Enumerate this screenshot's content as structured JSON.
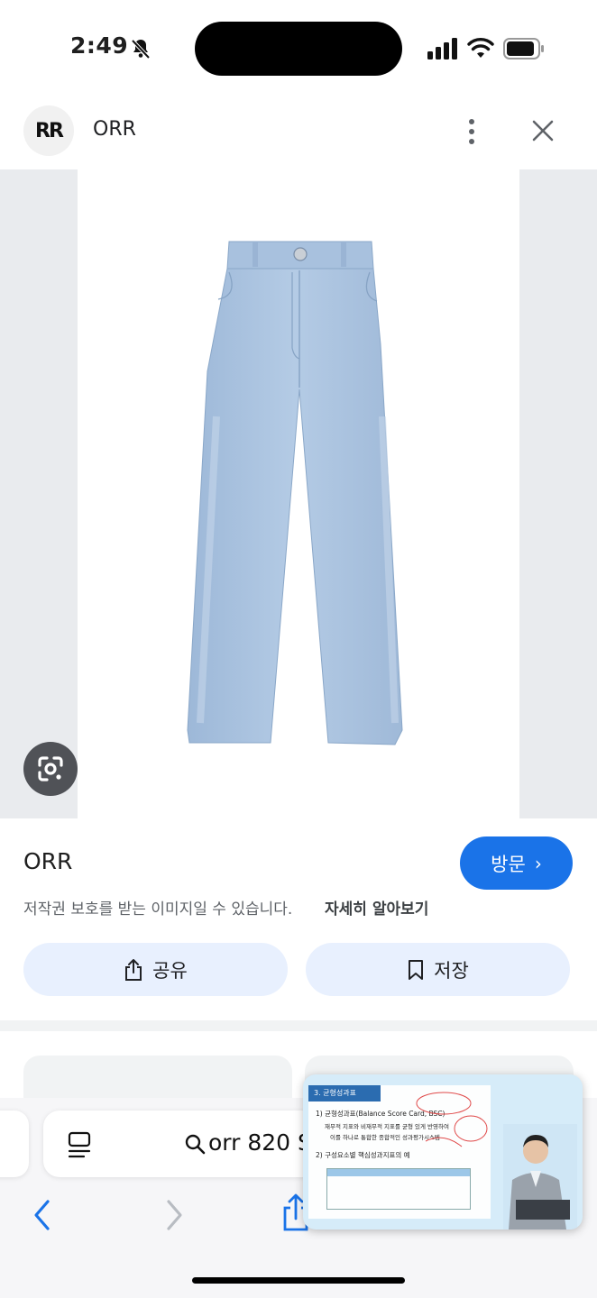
{
  "status_bar": {
    "time": "2:49"
  },
  "header": {
    "logo_text": "RR",
    "site_name": "ORR"
  },
  "product": {
    "title": "ORR",
    "visit_label": "방문",
    "copyright_notice": "저작권 보호를 받는 이미지일 수 있습니다.",
    "learn_more": "자세히 알아보기",
    "share_label": "공유",
    "save_label": "저장"
  },
  "browser": {
    "address_query": "orr 820 S"
  },
  "pip": {
    "slide_header": "3. 균형성과표",
    "line1": "1) 균형성과표(Balance Score Card, BSC)",
    "line2": "재무적 지표와 비재무적 지표를 균형 있게 반영하여",
    "line3": "이를 하나로 통합한 종합적인 성과평가시스템",
    "line4": "2) 구성요소별 핵심성과지표의 예"
  },
  "colors": {
    "accent": "#1a73e8",
    "pill": "#e8f0fe",
    "jeans": "#a9c2df"
  }
}
